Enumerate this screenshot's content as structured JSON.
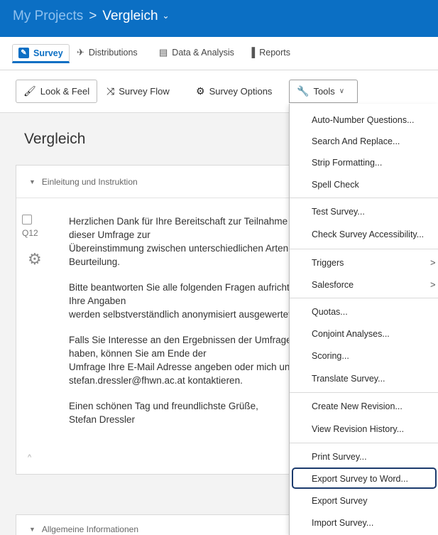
{
  "header": {
    "breadcrumb_root": "My Projects",
    "breadcrumb_sep": ">",
    "project_name": "Vergleich",
    "chevron": "⌄"
  },
  "tabs": [
    {
      "label": "Survey",
      "icon": "pencil-icon",
      "glyph": "✎"
    },
    {
      "label": "Distributions",
      "icon": "paper-plane-icon",
      "glyph": "✈"
    },
    {
      "label": "Data & Analysis",
      "icon": "chat-table-icon",
      "glyph": "▤"
    },
    {
      "label": "Reports",
      "icon": "bar-chart-icon",
      "glyph": "▐"
    }
  ],
  "toolbar": {
    "look_feel": "Look & Feel",
    "survey_flow": "Survey Flow",
    "survey_options": "Survey Options",
    "tools": "Tools",
    "look_glyph": "🖌",
    "flow_glyph": "⤨",
    "options_glyph": "⚙",
    "tools_glyph": "🔧",
    "chev": "∨"
  },
  "survey_title": "Vergleich",
  "blocks": [
    {
      "title": "Einleitung und Instruktion"
    },
    {
      "title": "Allgemeine Informationen"
    }
  ],
  "question": {
    "number": "Q12",
    "paragraphs": [
      "Herzlichen Dank für Ihre Bereitschaft zur Teilnahme an dieser Umfrage zur\nÜbereinstimmung zwischen unterschiedlichen Arten der Beurteilung.",
      "Bitte beantworten Sie alle folgenden Fragen aufrichtig. Ihre Angaben\nwerden selbstverständlich anonymisiert ausgewertet.",
      "Falls Sie Interesse an den Ergebnissen der Umfrage haben, können Sie am Ende der\nUmfrage Ihre E-Mail Adresse angeben oder mich unter\nstefan.dressler@fhwn.ac.at kontaktieren.",
      "Einen schönen Tag und freundlichste Grüße,\nStefan Dressler"
    ]
  },
  "tools_menu": [
    {
      "label": "Auto-Number Questions..."
    },
    {
      "label": "Search And Replace..."
    },
    {
      "label": "Strip Formatting..."
    },
    {
      "label": "Spell Check"
    },
    {
      "label": "Test Survey..."
    },
    {
      "label": "Check Survey Accessibility..."
    },
    {
      "label": "Triggers",
      "arrow": ">"
    },
    {
      "label": "Salesforce",
      "arrow": ">"
    },
    {
      "label": "Quotas..."
    },
    {
      "label": "Conjoint Analyses..."
    },
    {
      "label": "Scoring..."
    },
    {
      "label": "Translate Survey..."
    },
    {
      "label": "Create New Revision..."
    },
    {
      "label": "View Revision History..."
    },
    {
      "label": "Print Survey..."
    },
    {
      "label": "Export Survey to Word..."
    },
    {
      "label": "Export Survey"
    },
    {
      "label": "Import Survey..."
    }
  ]
}
